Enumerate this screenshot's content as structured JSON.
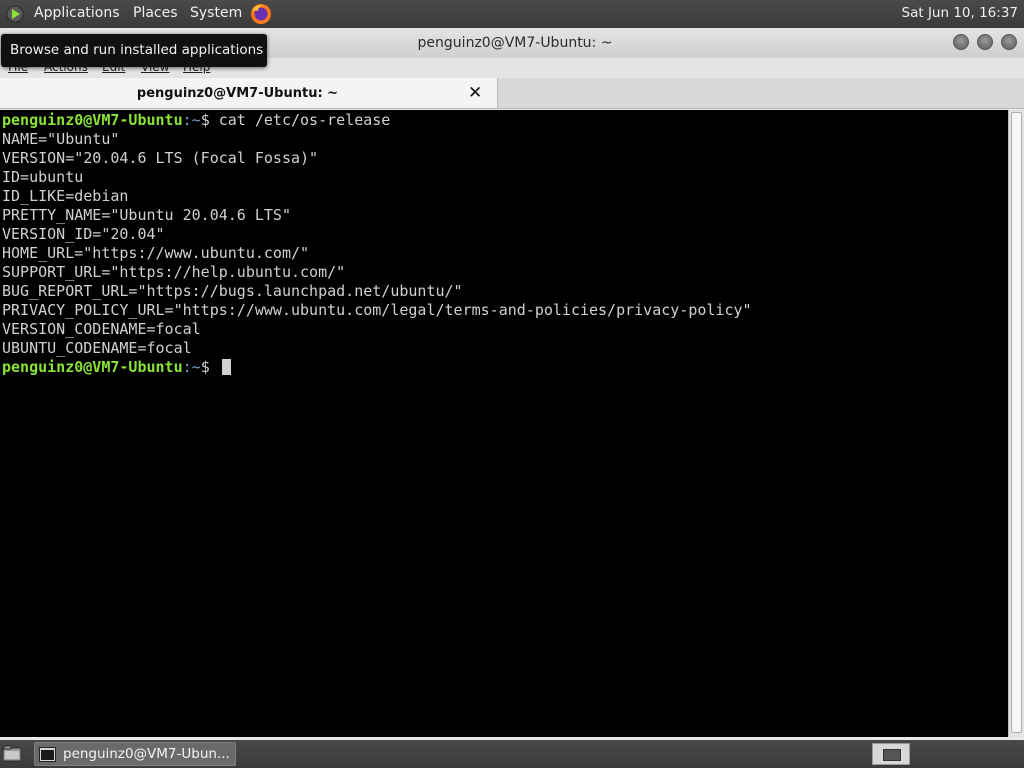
{
  "top_panel": {
    "menus": {
      "applications": "Applications",
      "places": "Places",
      "system": "System"
    },
    "clock": "Sat Jun 10, 16:37",
    "icons": {
      "applications": "run-icon",
      "browser": "firefox-icon"
    }
  },
  "tooltip": "Browse and run installed applications",
  "window": {
    "title": "penguinz0@VM7-Ubuntu: ~",
    "menubar": [
      "File",
      "Actions",
      "Edit",
      "View",
      "Help"
    ],
    "tab_label": "penguinz0@VM7-Ubuntu: ~",
    "tab_close": "✕"
  },
  "terminal": {
    "prompt_user": "penguinz0@VM7-Ubuntu",
    "prompt_path": ":~",
    "prompt_symbol": "$ ",
    "command": "cat /etc/os-release",
    "output": [
      "NAME=\"Ubuntu\"",
      "VERSION=\"20.04.6 LTS (Focal Fossa)\"",
      "ID=ubuntu",
      "ID_LIKE=debian",
      "PRETTY_NAME=\"Ubuntu 20.04.6 LTS\"",
      "VERSION_ID=\"20.04\"",
      "HOME_URL=\"https://www.ubuntu.com/\"",
      "SUPPORT_URL=\"https://help.ubuntu.com/\"",
      "BUG_REPORT_URL=\"https://bugs.launchpad.net/ubuntu/\"",
      "PRIVACY_POLICY_URL=\"https://www.ubuntu.com/legal/terms-and-policies/privacy-policy\"",
      "VERSION_CODENAME=focal",
      "UBUNTU_CODENAME=focal"
    ]
  },
  "bottom_panel": {
    "taskbar_item": "penguinz0@VM7-Ubun...",
    "icons": {
      "show_desktop": "show-desktop-icon",
      "task": "terminal-window-icon",
      "workspace": "workspace-switcher-icon"
    }
  },
  "colors": {
    "prompt_user": "#8ae234",
    "prompt_path": "#729fcf",
    "terminal_bg": "#000000",
    "terminal_fg": "#d0d0d0"
  }
}
